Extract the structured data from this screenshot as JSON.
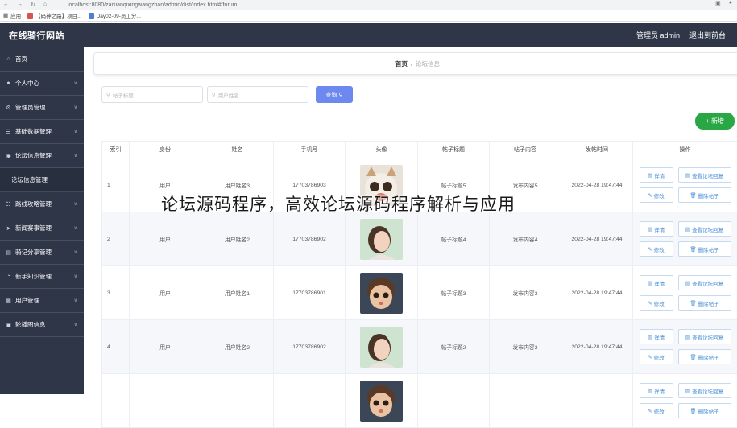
{
  "browser": {
    "url": "localhost:8080/zaixianqixingwangzhan/admin/dist/index.html#/forum",
    "bookmarks": [
      {
        "label": "应用"
      },
      {
        "label": "【码神之路】项目..."
      },
      {
        "label": "Day02-09-员工分..."
      }
    ]
  },
  "header": {
    "brand": "在线骑行网站",
    "admin_label": "管理员 admin",
    "logout_label": "退出到前台"
  },
  "sidebar": {
    "items": [
      {
        "icon": "home-icon",
        "glyph": "⌂",
        "label": "首页",
        "chevron": false
      },
      {
        "icon": "user-icon",
        "glyph": "●",
        "label": "个人中心",
        "chevron": true
      },
      {
        "icon": "gear-icon",
        "glyph": "⚙",
        "label": "管理员管理",
        "chevron": true
      },
      {
        "icon": "list-icon",
        "glyph": "☰",
        "label": "基础数据管理",
        "chevron": true
      },
      {
        "icon": "location-icon",
        "glyph": "◉",
        "label": "论坛信息管理",
        "chevron": true
      },
      {
        "icon": "",
        "glyph": "",
        "label": "论坛信息管理",
        "chevron": false,
        "sub": true
      },
      {
        "icon": "grid-icon",
        "glyph": "☷",
        "label": "路线攻略管理",
        "chevron": true
      },
      {
        "icon": "send-icon",
        "glyph": "➤",
        "label": "新闻赛事管理",
        "chevron": true
      },
      {
        "icon": "chart-icon",
        "glyph": "▤",
        "label": "骑记分享管理",
        "chevron": true
      },
      {
        "icon": "clock-icon",
        "glyph": "◔",
        "label": "新手知识管理",
        "chevron": true
      },
      {
        "icon": "users-icon",
        "glyph": "▦",
        "label": "用户管理",
        "chevron": true
      },
      {
        "icon": "image-icon",
        "glyph": "▣",
        "label": "轮播图信息",
        "chevron": true
      }
    ]
  },
  "breadcrumb": {
    "home": "首页",
    "separator": "/",
    "current": "论坛信息"
  },
  "search": {
    "title_placeholder": "帖子标题",
    "username_placeholder": "用户姓名",
    "button_label": "查询"
  },
  "add_button_label": "+ 新增",
  "table": {
    "headers": [
      "索引",
      "身份",
      "姓名",
      "手机号",
      "头像",
      "帖子标题",
      "帖子内容",
      "发帖时间",
      "操作"
    ],
    "rows": [
      {
        "index": "1",
        "role": "用户",
        "name": "用户姓名3",
        "phone": "17703786903",
        "avatar": "cat",
        "title": "帖子标题5",
        "content": "发布内容5",
        "time": "2022-04-28 19:47:44"
      },
      {
        "index": "2",
        "role": "用户",
        "name": "用户姓名2",
        "phone": "17703786902",
        "avatar": "girl",
        "title": "帖子标题4",
        "content": "发布内容4",
        "time": "2022-04-28 19:47:44"
      },
      {
        "index": "3",
        "role": "用户",
        "name": "用户姓名1",
        "phone": "17703786901",
        "avatar": "boy",
        "title": "帖子标题3",
        "content": "发布内容3",
        "time": "2022-04-28 19:47:44"
      },
      {
        "index": "4",
        "role": "用户",
        "name": "用户姓名2",
        "phone": "17703786902",
        "avatar": "girl",
        "title": "帖子标题2",
        "content": "发布内容2",
        "time": "2022-04-28 19:47:44"
      },
      {
        "index": "",
        "role": "",
        "name": "",
        "phone": "",
        "avatar": "boy",
        "title": "",
        "content": "",
        "time": ""
      }
    ],
    "actions": {
      "detail": "详情",
      "view_replies": "查看论坛回复",
      "edit": "修改",
      "delete": "删除帖子"
    }
  },
  "watermark": "论坛源码程序，高效论坛源码程序解析与应用",
  "colors": {
    "sidebar_bg": "#2f3648",
    "primary": "#6d88ee",
    "success": "#29a745",
    "action_text": "#4a90d9"
  }
}
